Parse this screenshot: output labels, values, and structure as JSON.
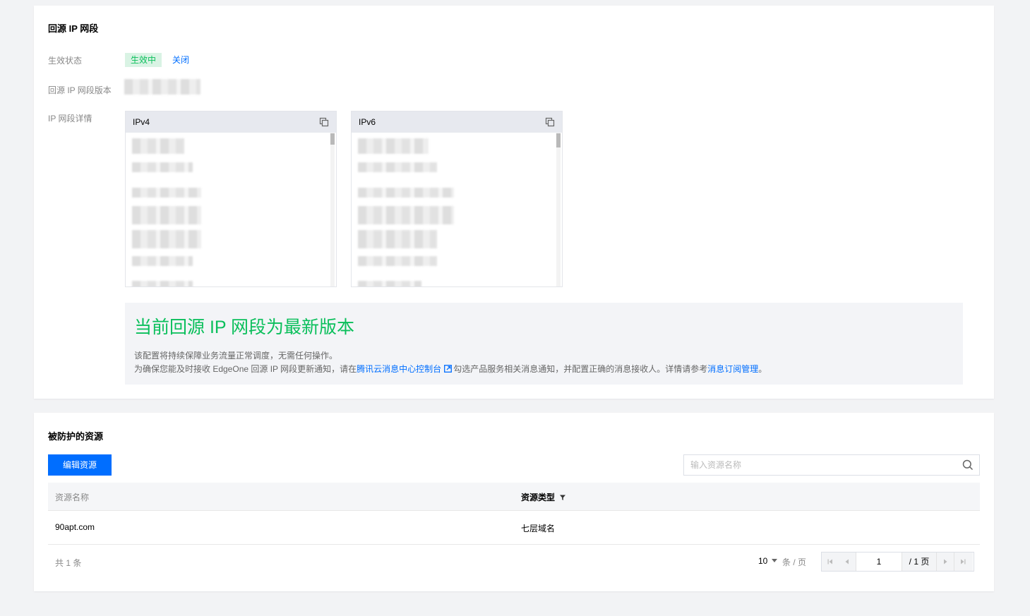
{
  "origin_ip_section": {
    "title": "回源 IP 网段",
    "status_label": "生效状态",
    "status_value": "生效中",
    "close_link": "关闭",
    "version_label": "回源 IP 网段版本",
    "detail_label": "IP 网段详情",
    "ipv4_title": "IPv4",
    "ipv6_title": "IPv6"
  },
  "notice": {
    "title": "当前回源 IP 网段为最新版本",
    "line1": "该配置将持续保障业务流量正常调度，无需任何操作。",
    "line2_before": "为确保您能及时接收 EdgeOne 回源 IP 网段更新通知，请在",
    "line2_link1": "腾讯云消息中心控制台",
    "line2_middle": "勾选产品服务相关消息通知，并配置正确的消息接收人。详情请参考",
    "line2_link2": "消息订阅管理",
    "line2_end": "。"
  },
  "protected_resources": {
    "title": "被防护的资源",
    "edit_button": "编辑资源",
    "search_placeholder": "输入资源名称",
    "columns": {
      "name": "资源名称",
      "type": "资源类型"
    },
    "rows": [
      {
        "name": "90apt.com",
        "type": "七层域名"
      }
    ],
    "total": "共 1 条",
    "page_size": "10",
    "per_page": "条 / 页",
    "current_page": "1",
    "total_pages": "/ 1 页"
  },
  "colors": {
    "primary": "#006eff",
    "success": "#0abf5b",
    "success_bg": "#d9f3e4"
  }
}
